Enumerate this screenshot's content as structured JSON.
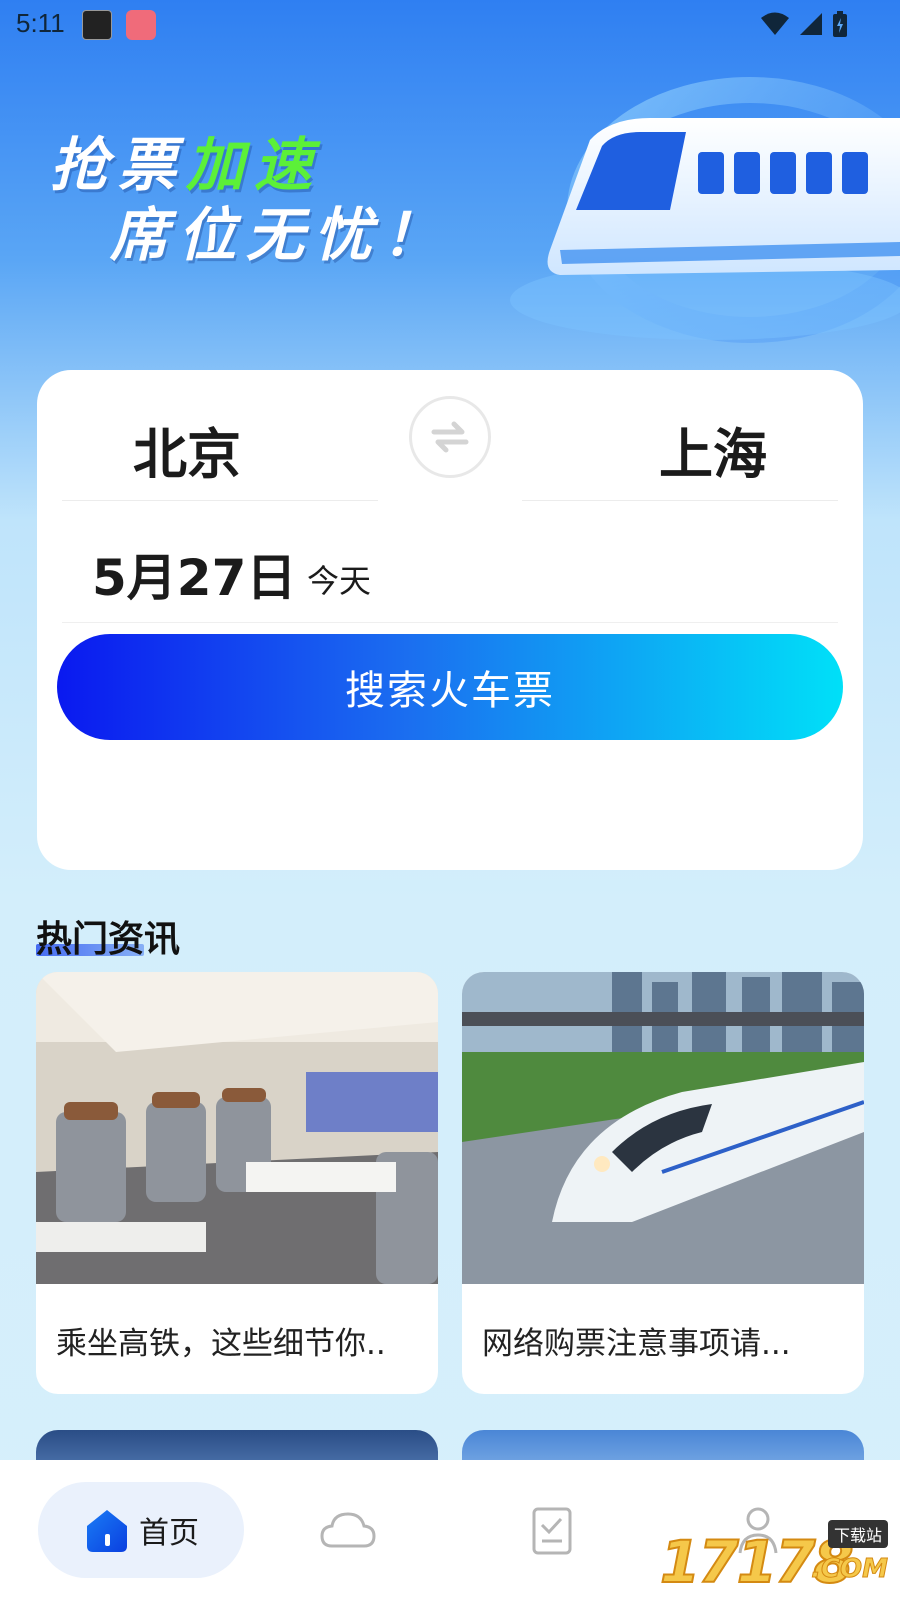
{
  "status_bar": {
    "time": "5:11"
  },
  "banner": {
    "line1_part1": "抢票",
    "line1_accent": "加速",
    "line2": "席位无忧！",
    "accent_color": "#5cf038"
  },
  "search": {
    "from_city": "北京",
    "to_city": "上海",
    "date": "5月27日",
    "date_hint": "今天",
    "button_label": "搜索火车票"
  },
  "news": {
    "section_title": "热门资讯",
    "items": [
      {
        "title": "乘坐高铁，这些细节你..",
        "image": "train-interior-photo"
      },
      {
        "title": "网络购票注意事项请...",
        "image": "high-speed-train-photo"
      }
    ]
  },
  "tabs": {
    "home_label": "首页",
    "items": [
      "home-icon",
      "cloud-icon",
      "clipboard-check-icon",
      "user-icon"
    ]
  },
  "watermark": {
    "brand": "17178",
    "tag": "下载站",
    "suffix": ".COM"
  },
  "colors": {
    "primary_gradient_start": "#0a19f0",
    "primary_gradient_end": "#00e0f8",
    "home_tab_bg": "#eaf1fc"
  }
}
